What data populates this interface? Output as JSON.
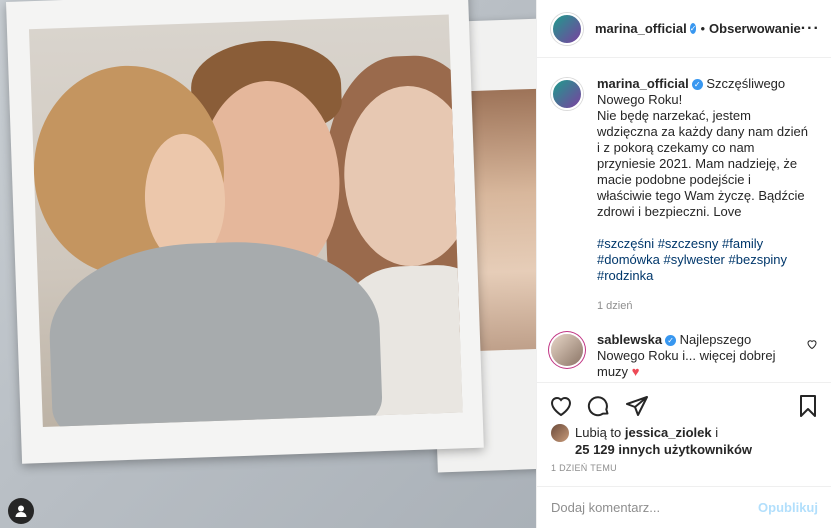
{
  "post": {
    "username": "marina_official",
    "follow_status": "Obserwowanie",
    "more_icon": "more-options-icon",
    "caption_lines": [
      "Szczęśliwego",
      "Nowego Roku!",
      "Nie będę narzekać, jestem",
      "wdzięczna za każdy dany nam dzień",
      "i z pokorą czekamy co nam",
      "przyniesie 2021. Mam nadzieję, że",
      "macie podobne podejście i",
      "właściwie tego Wam życzę. Bądźcie",
      "zdrowi i bezpieczni. Love"
    ],
    "hashtags": [
      "#szczęśni #szczesny #family",
      "#domówka #sylwester #bezspiny",
      "#rodzinka"
    ],
    "caption_time": "1 dzień"
  },
  "comment": {
    "username": "sablewska",
    "lines": [
      "Najlepszego",
      "Nowego Roku i... więcej dobrej",
      "muzy"
    ],
    "heart": "♥"
  },
  "likes": {
    "line1_prefix": "Lubią to ",
    "liker": "jessica_ziolek",
    "line1_suffix": " i",
    "line2": "25 129 innych użytkowników"
  },
  "post_time": "1 DZIEŃ TEMU",
  "add_comment": {
    "placeholder": "Dodaj komentarz...",
    "publish": "Opublikuj"
  },
  "colors": {
    "verified": "#3897f0",
    "hashtag": "#00376b",
    "publish_disabled": "#b2dffc"
  }
}
